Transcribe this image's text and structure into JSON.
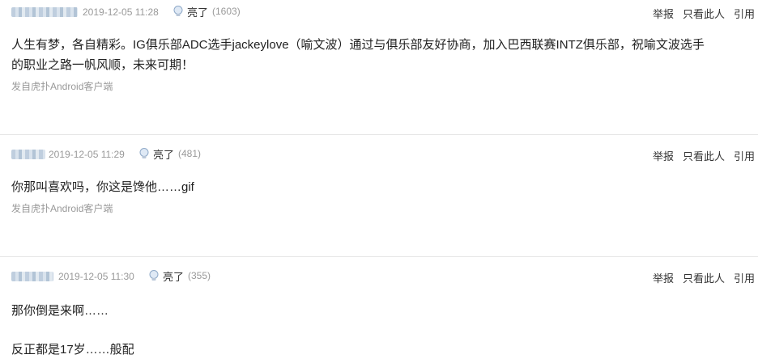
{
  "replies": [
    {
      "time": "2019-12-05 11:28",
      "light_label": "亮了",
      "light_count": "(1603)",
      "actions": [
        "举报",
        "只看此人",
        "引用"
      ],
      "content": [
        "人生有梦，各自精彩。IG俱乐部ADC选手jackeylove（喻文波）通过与俱乐部友好协商，加入巴西联赛INTZ俱乐部，祝喻文波选手",
        "的职业之路一帆风顺，未来可期！"
      ],
      "source": "发自虎扑Android客户端"
    },
    {
      "time": "2019-12-05 11:29",
      "light_label": "亮了",
      "light_count": "(481)",
      "actions": [
        "举报",
        "只看此人",
        "引用"
      ],
      "content": [
        "你那叫喜欢吗，你这是馋他……gif"
      ],
      "source": "发自虎扑Android客户端"
    },
    {
      "time": "2019-12-05 11:30",
      "light_label": "亮了",
      "light_count": "(355)",
      "actions": [
        "举报",
        "只看此人",
        "引用"
      ],
      "content": [
        "那你倒是来啊……",
        "反正都是17岁……般配"
      ]
    }
  ]
}
